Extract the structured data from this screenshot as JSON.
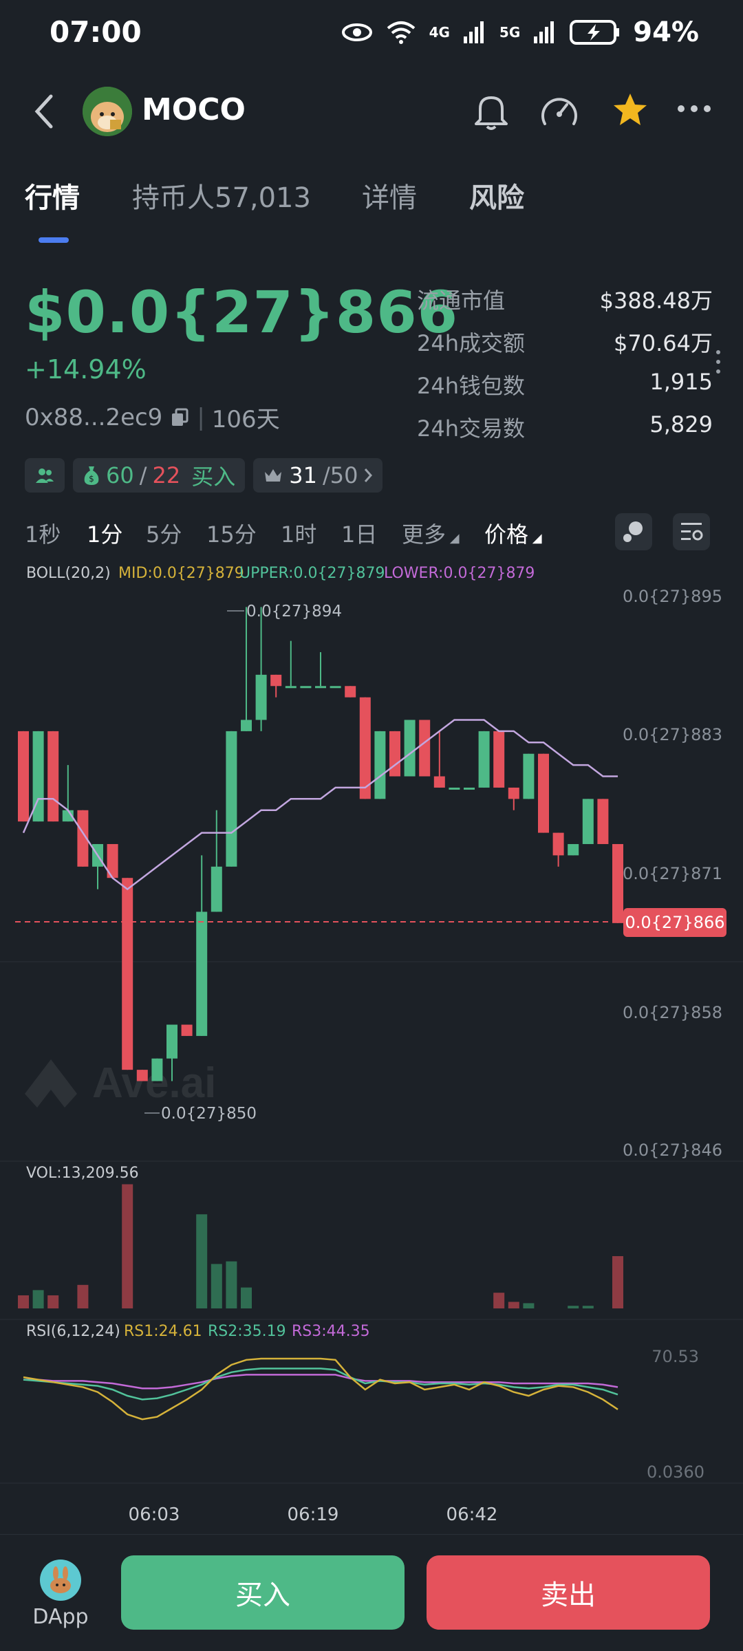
{
  "status": {
    "time": "07:00",
    "battery": "94%",
    "net1": "4G",
    "net2": "5G"
  },
  "header": {
    "title": "MOCO"
  },
  "tabs": [
    "行情",
    "持币人57,013",
    "详情",
    "风险"
  ],
  "price": {
    "value": "$0.0{27}866",
    "change": "+14.94%",
    "address": "0x88...2ec9",
    "age": "106天"
  },
  "stats": [
    {
      "label": "流通市值",
      "value": "$388.48万"
    },
    {
      "label": "24h成交额",
      "value": "$70.64万"
    },
    {
      "label": "24h钱包数",
      "value": "1,915"
    },
    {
      "label": "24h交易数",
      "value": "5,829"
    }
  ],
  "chips": {
    "smart_a": "60",
    "slash": "/",
    "smart_b": "22",
    "smart_label": "买入",
    "top_a": "31",
    "top_b": "/50"
  },
  "intervals": [
    "1秒",
    "1分",
    "5分",
    "15分",
    "1时",
    "1日",
    "更多",
    "价格"
  ],
  "chart_labels": {
    "boll": "BOLL(20,2)",
    "mid": "MID:0.0{27}879",
    "upper": "UPPER:0.0{27}879",
    "lower": "LOWER:0.0{27}879",
    "high_marker": "0.0{27}894",
    "low_marker": "0.0{27}850",
    "current": "0.0{27}866",
    "vol": "VOL:13,209.56",
    "rsi": "RSI(6,12,24)",
    "rs1": "RS1:24.61",
    "rs2": "RS2:35.19",
    "rs3": "RS3:44.35",
    "rsi_high": "70.53",
    "rsi_low": "0.0360",
    "watermark": "Ave.ai"
  },
  "chart_data": {
    "type": "candlestick",
    "y_ticks": [
      "0.0{27}895",
      "0.0{27}883",
      "0.0{27}871",
      "0.0{27}858",
      "0.0{27}846"
    ],
    "x_ticks": [
      "06:03",
      "06:19",
      "06:42"
    ],
    "ylim": [
      846,
      895
    ],
    "candles": [
      {
        "o": 883,
        "c": 875,
        "h": 883,
        "l": 875
      },
      {
        "o": 875,
        "c": 883,
        "h": 883,
        "l": 875
      },
      {
        "o": 883,
        "c": 875,
        "h": 883,
        "l": 875
      },
      {
        "o": 875,
        "c": 876,
        "h": 880,
        "l": 875
      },
      {
        "o": 876,
        "c": 871,
        "h": 876,
        "l": 871
      },
      {
        "o": 871,
        "c": 873,
        "h": 873,
        "l": 869
      },
      {
        "o": 873,
        "c": 870,
        "h": 873,
        "l": 870
      },
      {
        "o": 870,
        "c": 853,
        "h": 870,
        "l": 853
      },
      {
        "o": 853,
        "c": 852,
        "h": 853,
        "l": 852
      },
      {
        "o": 852,
        "c": 854,
        "h": 854,
        "l": 852
      },
      {
        "o": 854,
        "c": 857,
        "h": 857,
        "l": 852
      },
      {
        "o": 857,
        "c": 856,
        "h": 857,
        "l": 856
      },
      {
        "o": 856,
        "c": 867,
        "h": 872,
        "l": 856
      },
      {
        "o": 867,
        "c": 871,
        "h": 876,
        "l": 867
      },
      {
        "o": 871,
        "c": 883,
        "h": 883,
        "l": 871
      },
      {
        "o": 883,
        "c": 884,
        "h": 894,
        "l": 883
      },
      {
        "o": 884,
        "c": 888,
        "h": 894,
        "l": 883
      },
      {
        "o": 888,
        "c": 887,
        "h": 888,
        "l": 886
      },
      {
        "o": 887,
        "c": 887,
        "h": 891,
        "l": 887
      },
      {
        "o": 887,
        "c": 887,
        "h": 887,
        "l": 887
      },
      {
        "o": 887,
        "c": 887,
        "h": 890,
        "l": 887
      },
      {
        "o": 887,
        "c": 887,
        "h": 887,
        "l": 887
      },
      {
        "o": 887,
        "c": 886,
        "h": 887,
        "l": 886
      },
      {
        "o": 886,
        "c": 877,
        "h": 886,
        "l": 877
      },
      {
        "o": 877,
        "c": 883,
        "h": 883,
        "l": 877
      },
      {
        "o": 883,
        "c": 879,
        "h": 883,
        "l": 879
      },
      {
        "o": 879,
        "c": 884,
        "h": 884,
        "l": 879
      },
      {
        "o": 884,
        "c": 879,
        "h": 884,
        "l": 879
      },
      {
        "o": 879,
        "c": 878,
        "h": 883,
        "l": 878
      },
      {
        "o": 878,
        "c": 878,
        "h": 878,
        "l": 878
      },
      {
        "o": 878,
        "c": 878,
        "h": 878,
        "l": 878
      },
      {
        "o": 878,
        "c": 883,
        "h": 883,
        "l": 878
      },
      {
        "o": 883,
        "c": 878,
        "h": 883,
        "l": 878
      },
      {
        "o": 878,
        "c": 877,
        "h": 878,
        "l": 876
      },
      {
        "o": 877,
        "c": 881,
        "h": 881,
        "l": 877
      },
      {
        "o": 881,
        "c": 874,
        "h": 881,
        "l": 874
      },
      {
        "o": 874,
        "c": 872,
        "h": 874,
        "l": 871
      },
      {
        "o": 872,
        "c": 873,
        "h": 873,
        "l": 872
      },
      {
        "o": 873,
        "c": 877,
        "h": 877,
        "l": 873
      },
      {
        "o": 877,
        "c": 873,
        "h": 877,
        "l": 873
      },
      {
        "o": 873,
        "c": 866,
        "h": 873,
        "l": 866
      }
    ],
    "boll_mid": [
      874,
      877,
      877,
      876,
      874,
      872,
      870,
      869,
      870,
      871,
      872,
      873,
      874,
      874,
      874,
      875,
      876,
      876,
      877,
      877,
      877,
      878,
      878,
      878,
      879,
      880,
      881,
      882,
      883,
      884,
      884,
      884,
      883,
      883,
      882,
      882,
      881,
      880,
      880,
      879,
      879
    ],
    "volume": [
      10,
      14,
      10,
      0,
      18,
      0,
      0,
      95,
      0,
      0,
      0,
      0,
      72,
      34,
      36,
      16,
      0,
      0,
      0,
      0,
      0,
      0,
      0,
      0,
      0,
      0,
      0,
      0,
      0,
      0,
      0,
      0,
      12,
      5,
      4,
      0,
      0,
      2,
      2,
      0,
      40
    ],
    "rsi1": [
      60,
      58,
      56,
      54,
      52,
      48,
      40,
      30,
      26,
      28,
      35,
      42,
      50,
      62,
      70,
      74,
      75,
      75,
      75,
      75,
      75,
      74,
      60,
      50,
      58,
      55,
      56,
      50,
      52,
      54,
      50,
      56,
      53,
      48,
      45,
      50,
      53,
      52,
      48,
      42,
      34
    ],
    "rsi2": [
      58,
      57,
      56,
      55,
      54,
      53,
      50,
      45,
      42,
      43,
      46,
      50,
      54,
      60,
      64,
      66,
      67,
      67,
      67,
      67,
      67,
      66,
      60,
      55,
      57,
      56,
      56,
      54,
      55,
      55,
      54,
      55,
      54,
      52,
      51,
      52,
      54,
      54,
      52,
      50,
      46
    ],
    "rsi3": [
      58,
      58,
      57,
      57,
      57,
      56,
      55,
      53,
      51,
      51,
      52,
      54,
      56,
      59,
      61,
      62,
      62,
      62,
      62,
      62,
      62,
      62,
      59,
      57,
      57,
      57,
      57,
      56,
      56,
      56,
      56,
      56,
      56,
      55,
      55,
      55,
      55,
      55,
      55,
      54,
      52
    ]
  },
  "bottom": {
    "dapp": "DApp",
    "buy": "买入",
    "sell": "卖出"
  },
  "colors": {
    "up": "#4eb987",
    "down": "#e5525c",
    "mid": "#c3a7e0",
    "rs1": "#d6b33a",
    "rs2": "#52c39b",
    "rs3": "#c36ad8"
  }
}
